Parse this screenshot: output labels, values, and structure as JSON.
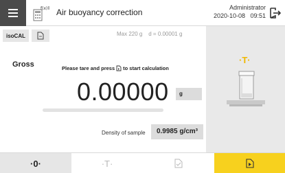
{
  "header": {
    "title": "Air buoyancy correction",
    "user": "Administrator",
    "datetime": "2020-10-08   09:51",
    "app_icon_text": "f(x)"
  },
  "toolbar": {
    "iso_label": "isoCAL",
    "capacity": "Max 220 g    d = 0.00001 g"
  },
  "main": {
    "mode": "Gross",
    "prompt_before": "Please tare and press",
    "prompt_after": "to start calculation",
    "weight": "0.00000",
    "unit": "g",
    "progress": 0,
    "density_label": "Density of sample",
    "density_value": "0.9985 g/cm³"
  },
  "side": {
    "tare_symbol": "·T·"
  },
  "bottom": {
    "zero_label": "·0·",
    "tare_label": "·T·"
  },
  "colors": {
    "accent": "#f7d11e",
    "tare_indicator": "#f0b800",
    "menu_bg": "#4a4a4a"
  }
}
